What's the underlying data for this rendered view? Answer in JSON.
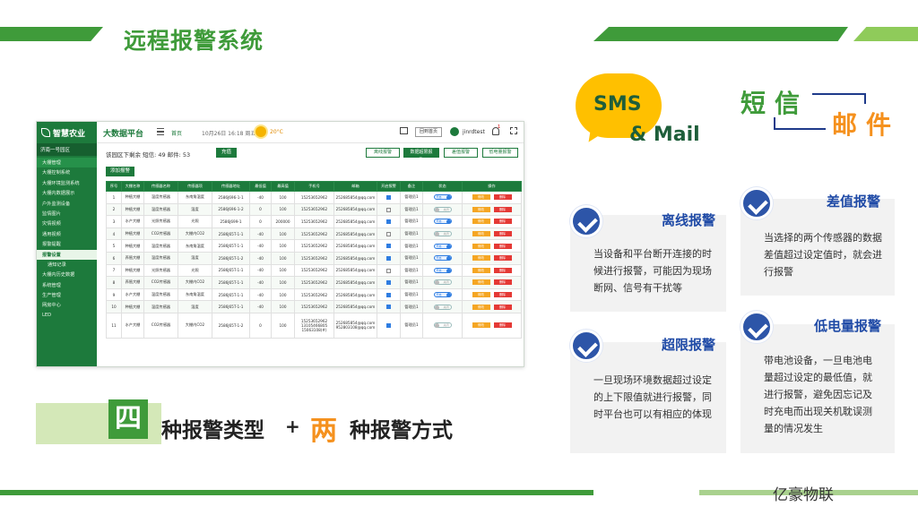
{
  "slide": {
    "title": "远程报警系统",
    "brand": "亿豪物联"
  },
  "app": {
    "logo": "智慧农业",
    "platform": "大数据平台",
    "home": "首页",
    "date": "10月26日 16:18 周五",
    "temperature": "20°C",
    "return_label": "回到首页",
    "user": "jinrdtest",
    "bell_count": "1",
    "region": "济南一号园区",
    "sidebar": [
      {
        "label": "大棚管理",
        "kind": "group"
      },
      {
        "label": "大棚控制系统",
        "kind": "item"
      },
      {
        "label": "大棚环境监测系统",
        "kind": "item"
      },
      {
        "label": "大棚内数据展示",
        "kind": "item"
      },
      {
        "label": "户外监测设备",
        "kind": "item"
      },
      {
        "label": "监情图片",
        "kind": "item"
      },
      {
        "label": "灾情视频",
        "kind": "item"
      },
      {
        "label": "通用视频",
        "kind": "item"
      },
      {
        "label": "报警提醒",
        "kind": "item"
      },
      {
        "label": "报警设置",
        "kind": "active"
      },
      {
        "label": "通知记录",
        "kind": "sub"
      },
      {
        "label": "大棚内历史数据",
        "kind": "item"
      },
      {
        "label": "系统管理",
        "kind": "item"
      },
      {
        "label": "生产管理",
        "kind": "item"
      },
      {
        "label": "网房中心",
        "kind": "item"
      },
      {
        "label": "LED",
        "kind": "item"
      }
    ],
    "balance_text": "该园区下剩余   短信: 49   邮件: 53",
    "recharge_label": "充值",
    "filters": [
      "离线报警",
      "数据超限报警",
      "差值报警",
      "低电量报警"
    ],
    "add_label": "添加报警",
    "table": {
      "headers": [
        "序号",
        "大棚名称",
        "传感器名称",
        "传感器项",
        "传感器地址",
        "最低值",
        "最高值",
        "手机号",
        "邮箱",
        "开启报警",
        "备注",
        "状态",
        "操作"
      ],
      "rows": [
        [
          "1",
          "种植大棚",
          "温度传感器",
          "东南角温度",
          "2586J696-1-1",
          "-40",
          "100",
          "15253652962",
          "252685854@qq.com",
          "on",
          "管理员1",
          "on"
        ],
        [
          "2",
          "种植大棚",
          "温度传感器",
          "湿度",
          "2586J696-1-2",
          "0",
          "100",
          "15253652962",
          "252685854@qq.com",
          "off",
          "管理员1",
          "off"
        ],
        [
          "3",
          "水产大棚",
          "光照传感器",
          "光照",
          "2586J699-1",
          "0",
          "200000",
          "15253652962",
          "252685854@qq.com",
          "on",
          "管理员1",
          "on"
        ],
        [
          "4",
          "种植大棚",
          "CO2传感器",
          "大棚内CO2",
          "2586J65T-1-1",
          "-40",
          "100",
          "15253652962",
          "252685854@qq.com",
          "off",
          "管理员1",
          "off"
        ],
        [
          "5",
          "种植大棚",
          "温度传感器",
          "东南角温度",
          "2586J65T-1-1",
          "-40",
          "100",
          "15253652962",
          "252685854@qq.com",
          "on",
          "管理员1",
          "on"
        ],
        [
          "6",
          "养殖大棚",
          "温度传感器",
          "湿度",
          "2586J65T-1-2",
          "-40",
          "100",
          "15253652962",
          "252685854@qq.com",
          "on",
          "管理员1",
          "on"
        ],
        [
          "7",
          "种植大棚",
          "光照传感器",
          "光照",
          "2586J65T-1-1",
          "-40",
          "100",
          "15253652962",
          "252685854@qq.com",
          "off",
          "管理员1",
          "on"
        ],
        [
          "8",
          "养殖大棚",
          "CO2传感器",
          "大棚内CO2",
          "2586J65T-1-1",
          "-40",
          "100",
          "15253652962",
          "252685854@qq.com",
          "on",
          "管理员1",
          "off"
        ],
        [
          "9",
          "水产大棚",
          "温度传感器",
          "东南角温度",
          "2586J65T-1-1",
          "-40",
          "100",
          "15253652962",
          "252685854@qq.com",
          "on",
          "管理员1",
          "on"
        ],
        [
          "10",
          "种植大棚",
          "温度传感器",
          "湿度",
          "2586J65T-1-1",
          "-40",
          "100",
          "15253652962",
          "252685854@qq.com",
          "on",
          "管理员1",
          "off"
        ],
        [
          "11",
          "水产大棚",
          "CO2传感器",
          "大棚内CO2",
          "2586J65T-1-2",
          "0",
          "100",
          "15253652962 13105466805 15063108(#)",
          "252685854@qq.com 952803108@qq.com",
          "on",
          "管理员1",
          "off"
        ]
      ],
      "toggle_on": "开启",
      "toggle_off": "关闭",
      "edit_label": "修改",
      "delete_label": "删除"
    }
  },
  "channels": {
    "sms": "SMS",
    "mail": "& Mail",
    "sms_cn": "短信",
    "mail_cn": "邮件"
  },
  "cards": {
    "offline": {
      "title": "离线报警",
      "text": "当设备和平台断开连接的时候进行报警，可能因为现场断网、信号有干扰等"
    },
    "diff": {
      "title": "差值报警",
      "text": "当选择的两个传感器的数据差值超过设定值时，就会进行报警"
    },
    "over": {
      "title": "超限报警",
      "text": "一旦现场环境数据超过设定的上下限值就进行报警，同时平台也可以有相应的体现"
    },
    "battery": {
      "title": "低电量报警",
      "text": "带电池设备，一旦电池电量超过设定的最低值，就进行报警，避免因忘记及时充电而出现关机耽误测量的情况发生"
    }
  },
  "summary": {
    "four": "四",
    "four_tail": "种报警类型",
    "plus": "+",
    "two": "两",
    "two_tail": "种报警方式"
  },
  "colors": {
    "brand_green": "#3f9b3a",
    "app_green": "#1d7a3c",
    "accent_orange": "#f5911e",
    "bubble_yellow": "#ffc000",
    "card_title_blue": "#1f4aa6"
  }
}
